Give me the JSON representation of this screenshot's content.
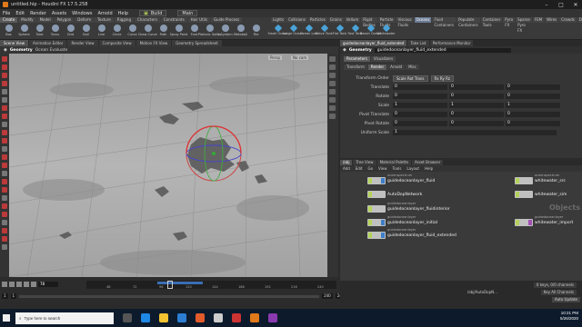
{
  "window": {
    "title": "untitled.hip - Houdini FX 17.5.258"
  },
  "menubar": {
    "items": [
      "File",
      "Edit",
      "Render",
      "Assets",
      "Windows",
      "Arnold",
      "Help"
    ],
    "desktop_build": "Build",
    "desktop_main": "Main"
  },
  "shelf": {
    "left_tabs": [
      "Create",
      "Modify",
      "Model",
      "Polygon",
      "Deform",
      "Texture",
      "Rigging",
      "Characters",
      "Constraints",
      "Hair Utils",
      "Guide Process"
    ],
    "left_tools": [
      "Box",
      "Sphere",
      "Tube",
      "Torus",
      "Grid",
      "Null",
      "Line",
      "Circle",
      "Curve",
      "Draw Curve",
      "Path",
      "Spray Paint",
      "Font",
      "Platonic Solids",
      "L-System",
      "Metaball",
      "File"
    ],
    "right_tabs": [
      "Lights",
      "Collisions",
      "Particles",
      "Grains",
      "Vellum",
      "Rigid Bodies",
      "Particle Fluids",
      "Viscous Fluids",
      "Oceans",
      "Fluid Containers",
      "Populate Containers",
      "Container Tools",
      "Pyro FX",
      "Sparse Pyro FX",
      "FEM",
      "Wires",
      "Crowds",
      "Drive"
    ],
    "right_tools": [
      "Small Ocean",
      "Large Ocean",
      "Ocean Lab",
      "Wave Tank",
      "Flat Tank",
      "Fast Tank",
      "Beach Ocean",
      "Whitewater"
    ]
  },
  "viewer": {
    "tabs": [
      "Scene View",
      "Animation Editor",
      "Render View",
      "Composite View",
      "Motion FX View",
      "Geometry Spreadsheet"
    ],
    "path_label": "Geometry",
    "path_node": "Ocean Evaluate",
    "persp": "Persp",
    "cam": "No cam"
  },
  "timeline": {
    "current_frame": "78",
    "ticks": [
      "48",
      "72",
      "96",
      "120",
      "144",
      "168",
      "192",
      "216",
      "240"
    ],
    "playhead_fraction": 0.325,
    "start": "1",
    "start2": "1",
    "end": "240",
    "end2": "240"
  },
  "parameters": {
    "tabs": [
      "guidedoceanlayer_fluid_extended",
      "Take List",
      "Performance Monitor"
    ],
    "path_label": "Geometry",
    "node_name": "guidedoceanlayer_fluid_extended",
    "panel_tabs": [
      "Parameters",
      "Visualizers"
    ],
    "sub_tabs": [
      "Transform",
      "Render",
      "Arnold",
      "Misc"
    ],
    "transform_order_label": "Transform Order",
    "transform_order_value": "Scale Rot Trans",
    "rotate_order_value": "Rx Ry Rz",
    "rows": [
      {
        "label": "Translate",
        "v": [
          "0",
          "0",
          "0"
        ]
      },
      {
        "label": "Rotate",
        "v": [
          "0",
          "0",
          "0"
        ]
      },
      {
        "label": "Scale",
        "v": [
          "1",
          "1",
          "1"
        ]
      },
      {
        "label": "Pivot Translate",
        "v": [
          "0",
          "0",
          "0"
        ]
      },
      {
        "label": "Pivot Rotate",
        "v": [
          "0",
          "0",
          "0"
        ]
      },
      {
        "label": "Uniform Scale",
        "v": [
          "1",
          "",
          ""
        ]
      }
    ]
  },
  "network": {
    "tabs": [
      "/obj",
      "Tree View",
      "Material Palette",
      "Asset Browser"
    ],
    "menu": [
      "Add",
      "Edit",
      "Go",
      "View",
      "Tools",
      "Layout",
      "Help"
    ],
    "nodes": [
      {
        "name": "guidedoceanlayer_fluid",
        "sub": "oceanspectrum",
        "color": "blue"
      },
      {
        "name": "whitewater_src",
        "sub": "oceanspectrum",
        "color": "none"
      },
      {
        "name": "AutoDopNetwork",
        "sub": "",
        "color": "none"
      },
      {
        "name": "whitewater_sim",
        "sub": "",
        "color": "none"
      },
      {
        "name": "guidedoceanlayer_fluidinterior",
        "sub": "guidedoceanlayer",
        "color": "none"
      },
      {
        "name": "guidedoceanlayer_initial",
        "sub": "guidedoceanlayer",
        "color": "blue"
      },
      {
        "name": "whitewater_import",
        "sub": "guidedoceanlayer",
        "color": "purple"
      },
      {
        "name": "guidedoceanlayer_fluid_extended",
        "sub": "guidedoceanlayer",
        "color": "blue"
      }
    ],
    "watermark": "Objects"
  },
  "status": {
    "keys": "0 keys, 0/0 channels",
    "key_all": "Key All Channels",
    "path": "/obj/AutoDopN...",
    "auto_update": "Auto Update"
  },
  "taskbar": {
    "search_placeholder": "Type here to search",
    "time": "10:21 PM",
    "date": "5/26/2020"
  }
}
